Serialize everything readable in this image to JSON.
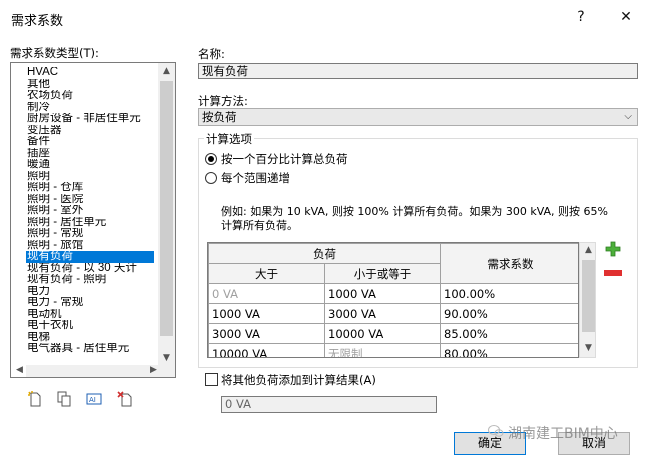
{
  "window": {
    "title": "需求系数",
    "help_label": "?",
    "close_label": "✕"
  },
  "left": {
    "types_label": "需求系数类型(T):",
    "items": [
      "HVAC",
      "其他",
      "农场负荷",
      "制冷",
      "厨房设备 - 非居住单元",
      "变压器",
      "备件",
      "插座",
      "暖通",
      "照明",
      "照明 - 仓库",
      "照明 - 医院",
      "照明 - 室外",
      "照明 - 居住单元",
      "照明 - 常规",
      "照明 - 旅馆",
      "现有负荷",
      "现有负荷 - 以 30 天计",
      "现有负荷 - 照明",
      "电力",
      "电力 - 常规",
      "电动机",
      "电干衣机",
      "电梯",
      "电气器具 - 居住单元"
    ],
    "selected_index": 16
  },
  "right": {
    "name_label": "名称:",
    "name_value": "现有负荷",
    "method_label": "计算方法:",
    "method_value": "按负荷",
    "options_title": "计算选项",
    "radio_all": "按一个百分比计算总负荷",
    "radio_range": "每个范围递增",
    "example_text": "例如: 如果为 10 kVA, 则按 100% 计算所有负荷。如果为 300 kVA, 则按 65% 计算所有负荷。",
    "grid": {
      "group_header": "负荷",
      "col_gt": "大于",
      "col_le": "小于或等于",
      "col_factor": "需求系数",
      "rows": [
        {
          "gt": "0 VA",
          "le": "1000 VA",
          "factor": "100.00%"
        },
        {
          "gt": "1000 VA",
          "le": "3000 VA",
          "factor": "90.00%"
        },
        {
          "gt": "3000 VA",
          "le": "10000 VA",
          "factor": "85.00%"
        },
        {
          "gt": "10000 VA",
          "le": "无限制",
          "factor": "80.00%"
        }
      ]
    },
    "add_other_label": "将其他负荷添加到计算结果(A)",
    "other_value": "0 VA"
  },
  "footer": {
    "ok_label": "确定",
    "cancel_label": "取消",
    "watermark": "湖南建工BIM中心"
  }
}
